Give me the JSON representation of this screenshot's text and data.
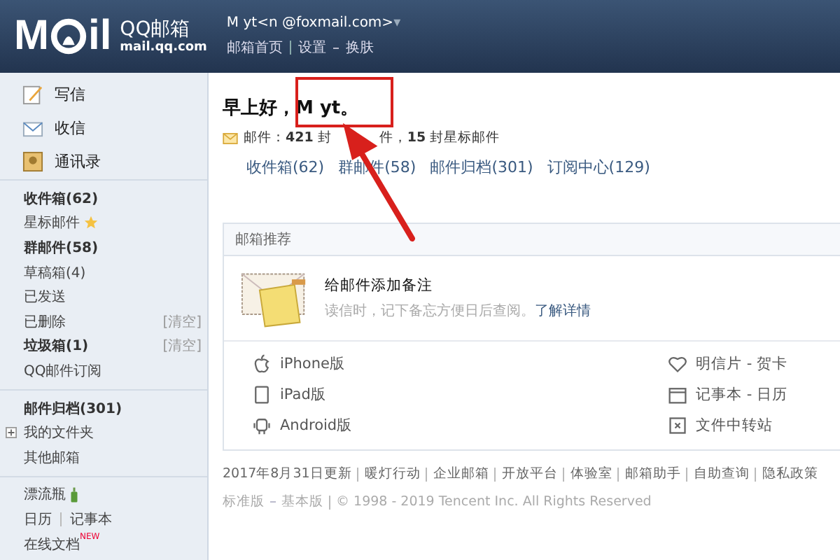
{
  "header": {
    "logo": {
      "left": "M",
      "right": "il",
      "name": "QQ邮箱",
      "domain": "mail.qq.com"
    },
    "account": "M yt<n @foxmail.com>",
    "account_caret": "▾",
    "links": [
      {
        "label": "邮箱首页"
      },
      {
        "label": "设置"
      },
      {
        "label": "换肤"
      }
    ]
  },
  "sidebar": {
    "actions": [
      {
        "label": "写信",
        "kind": "compose"
      },
      {
        "label": "收信",
        "kind": "inbox"
      },
      {
        "label": "通讯录",
        "kind": "contacts"
      }
    ],
    "groups": [
      [
        {
          "label": "收件箱(62)",
          "unread": true
        },
        {
          "label": "星标邮件",
          "unread": false,
          "kind": "star"
        },
        {
          "label": "群邮件(58)",
          "unread": true
        },
        {
          "label": "草稿箱(4)",
          "unread": false
        },
        {
          "label": "已发送",
          "unread": false
        },
        {
          "label": "已删除",
          "unread": false,
          "action": "[清空]"
        },
        {
          "label": "垃圾箱(1)",
          "unread": true,
          "action": "[清空]"
        },
        {
          "label": "QQ邮件订阅",
          "unread": false
        }
      ],
      [
        {
          "label": "邮件归档(301)",
          "unread": true
        },
        {
          "label": "我的文件夹",
          "unread": false,
          "expanded": false
        },
        {
          "label": "其他邮箱",
          "unread": false
        }
      ],
      [
        {
          "label": "漂流瓶",
          "unread": false,
          "kind": "bottle"
        },
        {
          "label": "日历",
          "unread": false,
          "extra": "记事本"
        },
        {
          "label": "在线文档",
          "unread": false,
          "badge": "NEW"
        }
      ]
    ]
  },
  "main": {
    "greeting": "早上好，M yt。",
    "stats": [
      "邮件：**421** 封",
      "件，**15** 封星标邮件"
    ],
    "folders": [
      {
        "label": "收件箱(62)"
      },
      {
        "label": "群邮件(58)"
      },
      {
        "label": "邮件归档(301)"
      },
      {
        "label": "订阅中心(129)"
      }
    ],
    "recommend": {
      "title": "邮箱推荐",
      "feature_title": "给邮件添加备注",
      "feature_desc": "读信时，记下备忘方便日后查阅。",
      "feature_link": "了解详情",
      "apps": [
        {
          "label": "iPhone版",
          "kind": "apple"
        },
        {
          "label": "明信片 - 贺卡",
          "kind": "heart"
        },
        {
          "label": "iPad版",
          "kind": "tablet"
        },
        {
          "label": "记事本 - 日历",
          "kind": "calendar"
        },
        {
          "label": "Android版",
          "kind": "android"
        },
        {
          "label": "文件中转站",
          "kind": "file"
        }
      ]
    },
    "footer": {
      "links": [
        {
          "label": "2017年8月31日更新"
        },
        {
          "label": "暖灯行动"
        },
        {
          "label": "企业邮箱"
        },
        {
          "label": "开放平台"
        },
        {
          "label": "体验室"
        },
        {
          "label": "邮箱助手"
        },
        {
          "label": "自助查询"
        },
        {
          "label": "隐私政策"
        }
      ],
      "versions": [
        {
          "label": "标准版"
        },
        {
          "label": "基本版"
        }
      ],
      "copyright": "© 1998 - 2019 Tencent Inc. All Rights Reserved"
    }
  }
}
